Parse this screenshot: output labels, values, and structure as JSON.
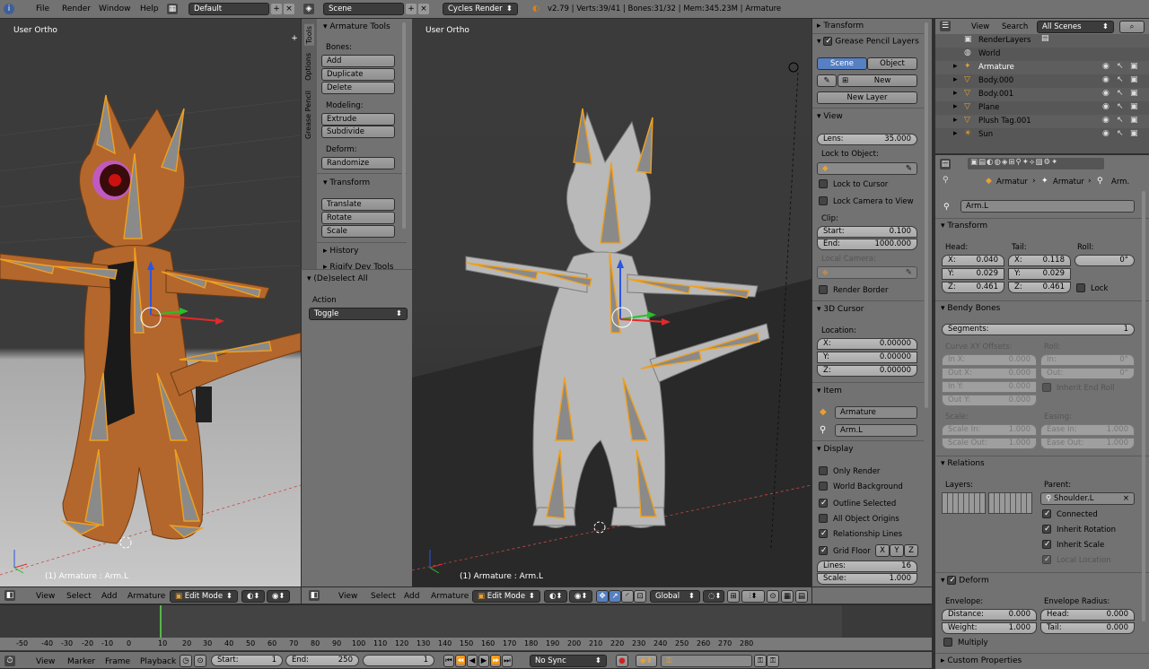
{
  "topbar": {
    "menus": [
      "File",
      "Render",
      "Window",
      "Help"
    ],
    "layout": "Default",
    "scene": "Scene",
    "engine": "Cycles Render",
    "stats": "v2.79 | Verts:39/41 | Bones:31/32 | Mem:345.23M | Armature"
  },
  "viewport_left": {
    "label": "User Ortho",
    "status": "(1) Armature : Arm.L"
  },
  "viewport_center": {
    "label": "User Ortho",
    "status": "(1) Armature : Arm.L"
  },
  "toolshelf": {
    "tabs": [
      "Tools",
      "Options",
      "Grease Pencil"
    ],
    "title": "Armature Tools",
    "bones_label": "Bones:",
    "bones_buttons": [
      "Add",
      "Duplicate",
      "Delete"
    ],
    "modeling_label": "Modeling:",
    "modeling_buttons": [
      "Extrude",
      "Subdivide"
    ],
    "deform_label": "Deform:",
    "deform_buttons": [
      "Randomize"
    ],
    "transform_title": "Transform",
    "transform_buttons": [
      "Translate",
      "Rotate",
      "Scale"
    ],
    "history": "History",
    "rigify": "Rigify Dev Tools"
  },
  "operator": {
    "title": "(De)select All",
    "action_label": "Action",
    "action_value": "Toggle"
  },
  "npanel": {
    "transform": "Transform",
    "grease_pencil": "Grease Pencil Layers",
    "gp_scene": "Scene",
    "gp_object": "Object",
    "gp_new": "New",
    "gp_newlayer": "New Layer",
    "view": "View",
    "lens_label": "Lens:",
    "lens_value": "35.000",
    "lock_object": "Lock to Object:",
    "lock_cursor": "Lock to Cursor",
    "lock_camera": "Lock Camera to View",
    "clip": "Clip:",
    "clip_start_label": "Start:",
    "clip_start": "0.100",
    "clip_end_label": "End:",
    "clip_end": "1000.000",
    "local_camera": "Local Camera:",
    "render_border": "Render Border",
    "cursor": "3D Cursor",
    "location": "Location:",
    "cx": "X:",
    "cxv": "0.00000",
    "cy": "Y:",
    "cyv": "0.00000",
    "cz": "Z:",
    "czv": "0.00000",
    "item": "Item",
    "item_obj": "Armature",
    "item_bone": "Arm.L",
    "display": "Display",
    "only_render": "Only Render",
    "world_bg": "World Background",
    "outline_sel": "Outline Selected",
    "all_origins": "All Object Origins",
    "rel_lines": "Relationship Lines",
    "grid_floor": "Grid Floor",
    "axes": [
      "X",
      "Y",
      "Z"
    ],
    "lines_label": "Lines:",
    "lines_value": "16",
    "scale_label": "Scale:",
    "scale_value": "1.000"
  },
  "outliner": {
    "view": "View",
    "search": "Search",
    "filter": "All Scenes",
    "items": [
      "RenderLayers",
      "World",
      "Armature",
      "Body.000",
      "Body.001",
      "Plane",
      "Plush Tag.001",
      "Sun"
    ]
  },
  "properties": {
    "crumbs": [
      "Armatur",
      "Armatur",
      "Arm."
    ],
    "bone_name": "Arm.L",
    "transform": "Transform",
    "head": "Head:",
    "tail": "Tail:",
    "roll": "Roll:",
    "hx": "X:",
    "hxv": "0.040",
    "hy": "Y:",
    "hyv": "0.029",
    "hz": "Z:",
    "hzv": "0.461",
    "tx": "X:",
    "txv": "0.118",
    "ty": "Y:",
    "tyv": "0.029",
    "tz": "Z:",
    "tzv": "0.461",
    "rollv": "0°",
    "lock": "Lock",
    "bendy": "Bendy Bones",
    "segments_label": "Segments:",
    "segments": "1",
    "curve_offsets": "Curve XY Offsets:",
    "bb_roll": "Roll:",
    "inx": "In X:",
    "inxv": "0.000",
    "outx": "Out X:",
    "outxv": "0.000",
    "iny": "In Y:",
    "inyv": "0.000",
    "outy": "Out Y:",
    "outyv": "0.000",
    "rin": "In:",
    "rinv": "0°",
    "rout": "Out:",
    "routv": "0°",
    "inherit_end_roll": "Inherit End Roll",
    "scale": "Scale:",
    "easing": "Easing:",
    "scale_in": "Scale In:",
    "scale_inv": "1.000",
    "scale_out": "Scale Out:",
    "scale_outv": "1.000",
    "ease_in": "Ease In:",
    "ease_inv": "1.000",
    "ease_out": "Ease Out:",
    "ease_outv": "1.000",
    "relations": "Relations",
    "layers": "Layers:",
    "parent": "Parent:",
    "parent_value": "Shoulder.L",
    "connected": "Connected",
    "inherit_rot": "Inherit Rotation",
    "inherit_scale": "Inherit Scale",
    "local_loc": "Local Location",
    "deform": "Deform",
    "envelope": "Envelope:",
    "env_radius": "Envelope Radius:",
    "distance": "Distance:",
    "distancev": "0.000",
    "weight": "Weight:",
    "weightv": "1.000",
    "rhead": "Head:",
    "rheadv": "0.000",
    "rtail": "Tail:",
    "rtailv": "0.000",
    "multiply": "Multiply",
    "custom": "Custom Properties"
  },
  "view3d_header": {
    "menus": [
      "View",
      "Select",
      "Add",
      "Armature"
    ],
    "mode": "Edit Mode",
    "orientation": "Global"
  },
  "timeline": {
    "ticks": [
      "-50",
      "-40",
      "-30",
      "-20",
      "-10",
      "0",
      "10",
      "20",
      "30",
      "40",
      "50",
      "60",
      "70",
      "80",
      "90",
      "100",
      "110",
      "120",
      "130",
      "140",
      "150",
      "160",
      "170",
      "180",
      "190",
      "200",
      "210",
      "220",
      "230",
      "240",
      "250",
      "260",
      "270",
      "280"
    ],
    "menus": [
      "View",
      "Marker",
      "Frame",
      "Playback"
    ],
    "start_label": "Start:",
    "start": "1",
    "end_label": "End:",
    "end": "250",
    "current": "1",
    "sync": "No Sync"
  }
}
